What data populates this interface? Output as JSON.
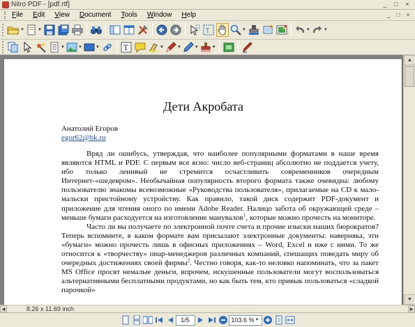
{
  "window": {
    "title": "Nitro PDF - [pdf.rtf]",
    "controls": [
      "_",
      "□",
      "×"
    ]
  },
  "menu": {
    "items": [
      "File",
      "Edit",
      "View",
      "Document",
      "Tools",
      "Window",
      "Help"
    ],
    "doc_controls": [
      "_",
      "□",
      "×"
    ]
  },
  "document": {
    "title": "Дети Акробата",
    "author": "Анатолий Егоров",
    "email": "egor62@bk.ru",
    "paragraphs": [
      {
        "text": "Вряд ли ошибусь, утверждая, что наиболее популярными форматами в наше время являются HTML и PDF. С первым все ясно: число веб-страниц абсолютно не поддается учету, ибо только ленивый не стремится осчастливить современников очередным Интернет-«шедевром». Необычайная популярность второго формата также очевидна: любому пользователю знакомы всевозможные «Руководства пользователя», прилагаемые на CD к мало-мальски пристойному устройству. Как правило, такой диск содержит PDF-документ и приложение для чтения оного по имени Adobe Reader. Налицо забота об окружающей среде – меньше бумаги расходуется на изготовление манувалов",
        "footnote": "1",
        "tail": ", которые можно прочесть на мониторе."
      },
      {
        "text": "Часто ли вы получаете по электронной почте счета и прочие изыски наших бюрократов? Теперь вспомните, в каком формате вам присылают электронные документы: наверняка, эти «бумаги» можно прочесть лишь в офисных приложениях – Word, Excel и иже с ними. То же относится к «творчеству» пиар-менеджеров различных компаний, спешащих поведать миру об очередных достижениях своей фирмы",
        "footnote": "2",
        "tail": ". Честно говоря, как-то неловко напоминать, что за пакет MS Office просят немалые деньги, впрочем, искушенные пользователи могут воспользоваться альтернативными бесплатными продуктами, но как быть тем, кто привык пользоваться «сладкой парочкой»"
      }
    ]
  },
  "status": {
    "page_size": "8.26 x 11.69 inch",
    "page_indicator": "1/5",
    "zoom": "103.6 %"
  },
  "colors": {
    "chrome": "#ece9d8",
    "workspace": "#808080",
    "link": "#1a4fb5",
    "active_tool": "#fde9a8"
  }
}
